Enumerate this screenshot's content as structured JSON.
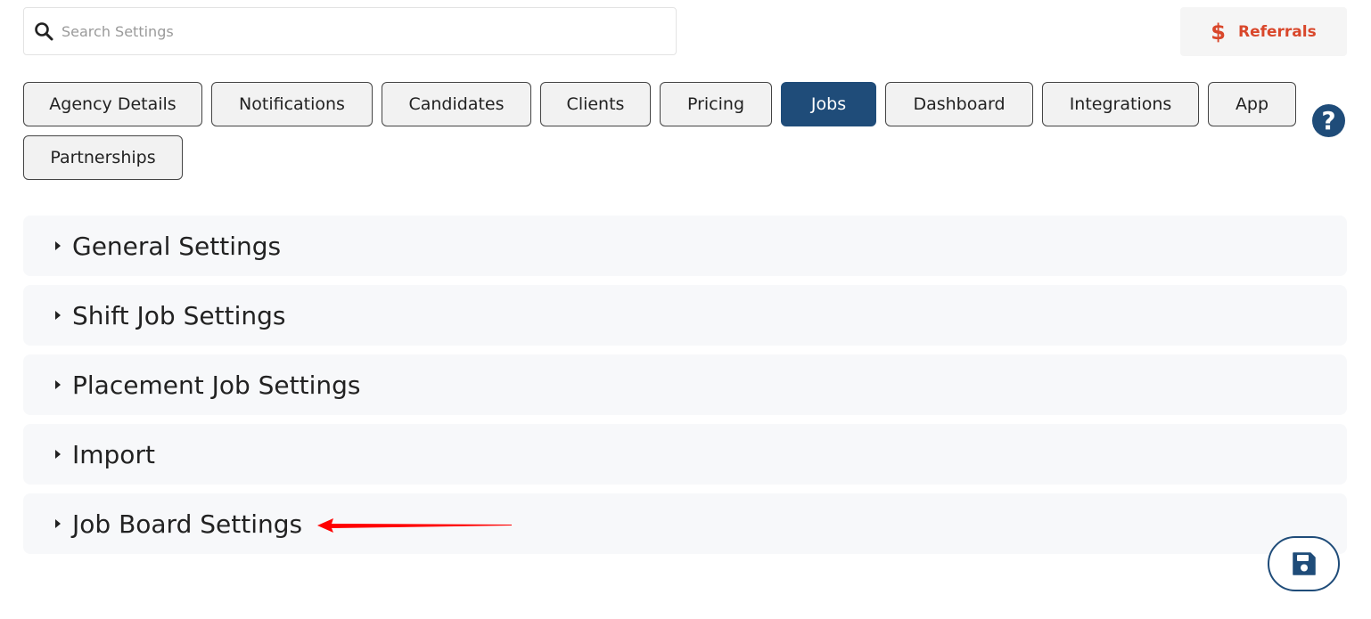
{
  "search": {
    "placeholder": "Search Settings",
    "value": ""
  },
  "referrals": {
    "label": "Referrals",
    "icon": "$"
  },
  "tabs": [
    {
      "label": "Agency Details",
      "active": false
    },
    {
      "label": "Notifications",
      "active": false
    },
    {
      "label": "Candidates",
      "active": false
    },
    {
      "label": "Clients",
      "active": false
    },
    {
      "label": "Pricing",
      "active": false
    },
    {
      "label": "Jobs",
      "active": true
    },
    {
      "label": "Dashboard",
      "active": false
    },
    {
      "label": "Integrations",
      "active": false
    },
    {
      "label": "App",
      "active": false
    },
    {
      "label": "Partnerships",
      "active": false
    }
  ],
  "help": {
    "icon": "?"
  },
  "sections": [
    {
      "label": "General Settings"
    },
    {
      "label": "Shift Job Settings"
    },
    {
      "label": "Placement Job Settings"
    },
    {
      "label": "Import"
    },
    {
      "label": "Job Board Settings"
    }
  ],
  "colors": {
    "primary": "#1f4c79",
    "referral": "#d9472b",
    "annotation_arrow": "#ff0000"
  }
}
